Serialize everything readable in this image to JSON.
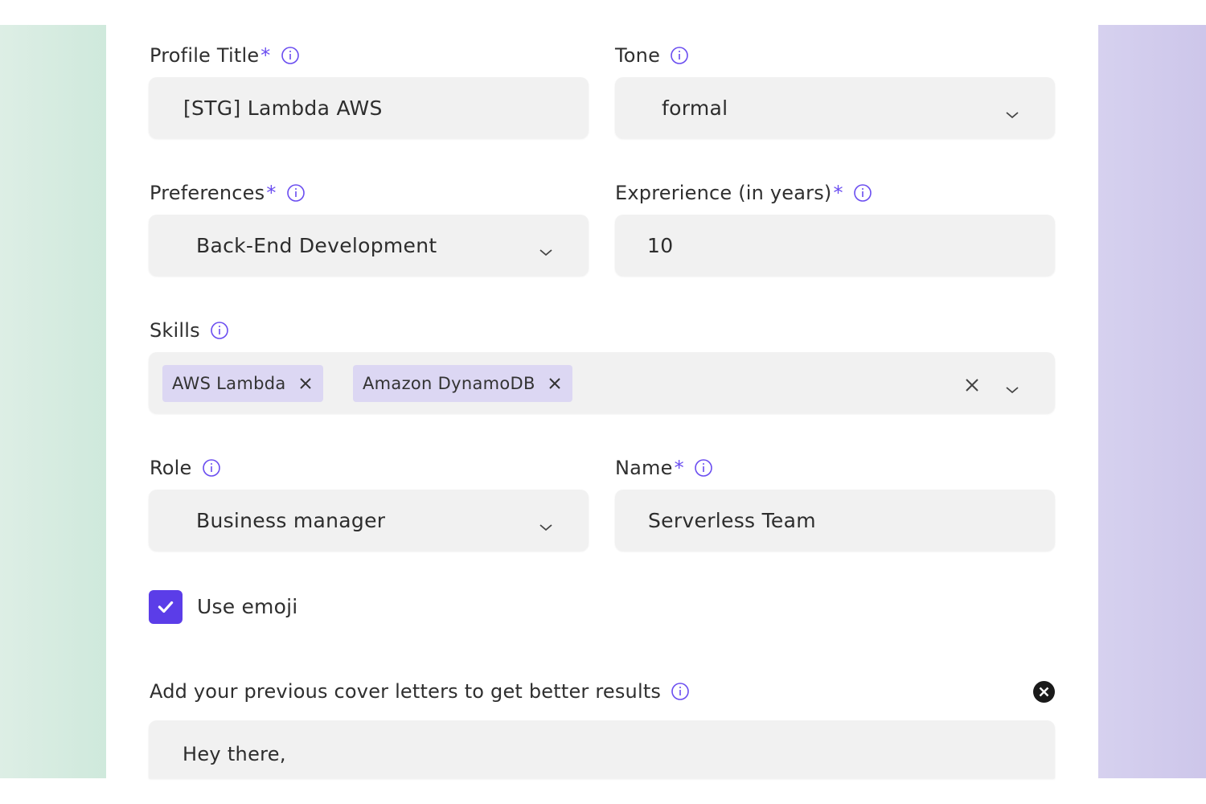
{
  "colors": {
    "accent": "#6a4df0",
    "checkbox": "#5b3de8",
    "chip_bg": "#dcd7f3",
    "field_bg": "#f1f1f1"
  },
  "profile_title": {
    "label": "Profile Title",
    "required_mark": "*",
    "value": "[STG] Lambda AWS"
  },
  "tone": {
    "label": "Tone",
    "selected": "formal"
  },
  "preferences": {
    "label": "Preferences",
    "required_mark": "*",
    "selected": "Back-End Development"
  },
  "experience": {
    "label": "Exprerience (in years)",
    "required_mark": "*",
    "value": "10"
  },
  "skills": {
    "label": "Skills",
    "chips": [
      "AWS Lambda",
      "Amazon DynamoDB"
    ]
  },
  "role": {
    "label": "Role",
    "selected": "Business manager"
  },
  "name": {
    "label": "Name",
    "required_mark": "*",
    "value": "Serverless Team"
  },
  "use_emoji": {
    "label": "Use emoji",
    "checked": true
  },
  "cover_letters": {
    "label": "Add your previous cover letters to get better results",
    "text": "Hey there,"
  },
  "icons": [
    "info-icon",
    "chevron-down-icon",
    "close-icon",
    "check-icon",
    "clear-circle-icon"
  ]
}
